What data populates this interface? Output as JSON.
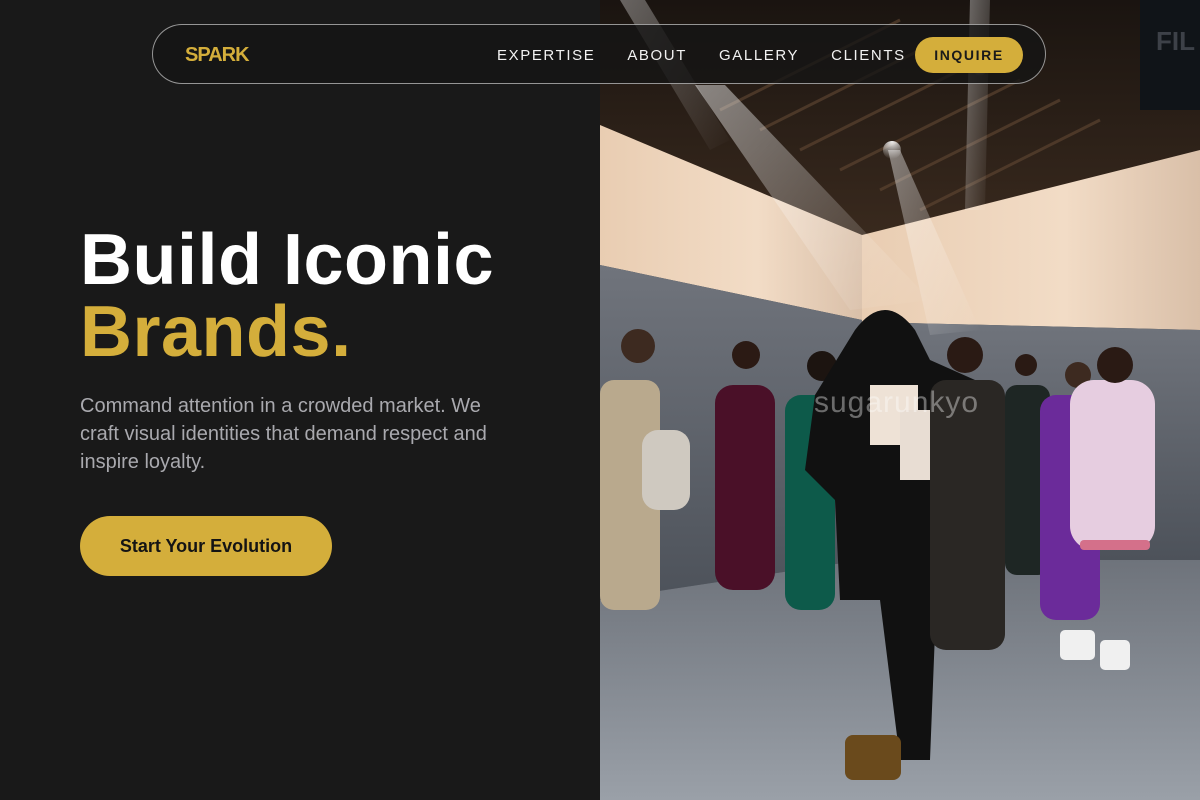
{
  "nav": {
    "logo": "SPARK",
    "links": [
      "EXPERTISE",
      "ABOUT",
      "GALLERY",
      "CLIENTS"
    ],
    "cta_label": "INQUIRE"
  },
  "hero": {
    "title_line1": "Build Iconic",
    "title_line2": "Brands.",
    "subtitle": "Command attention in a crowded market. We craft visual identities that demand respect and inspire loyalty.",
    "cta_label": "Start Your Evolution"
  },
  "photo": {
    "watermark": "sugarunkyo",
    "wall_sign": "FIL"
  },
  "colors": {
    "background": "#191919",
    "accent": "#d4ae3b",
    "text_primary": "#ffffff",
    "text_muted": "#a9a9ae"
  }
}
